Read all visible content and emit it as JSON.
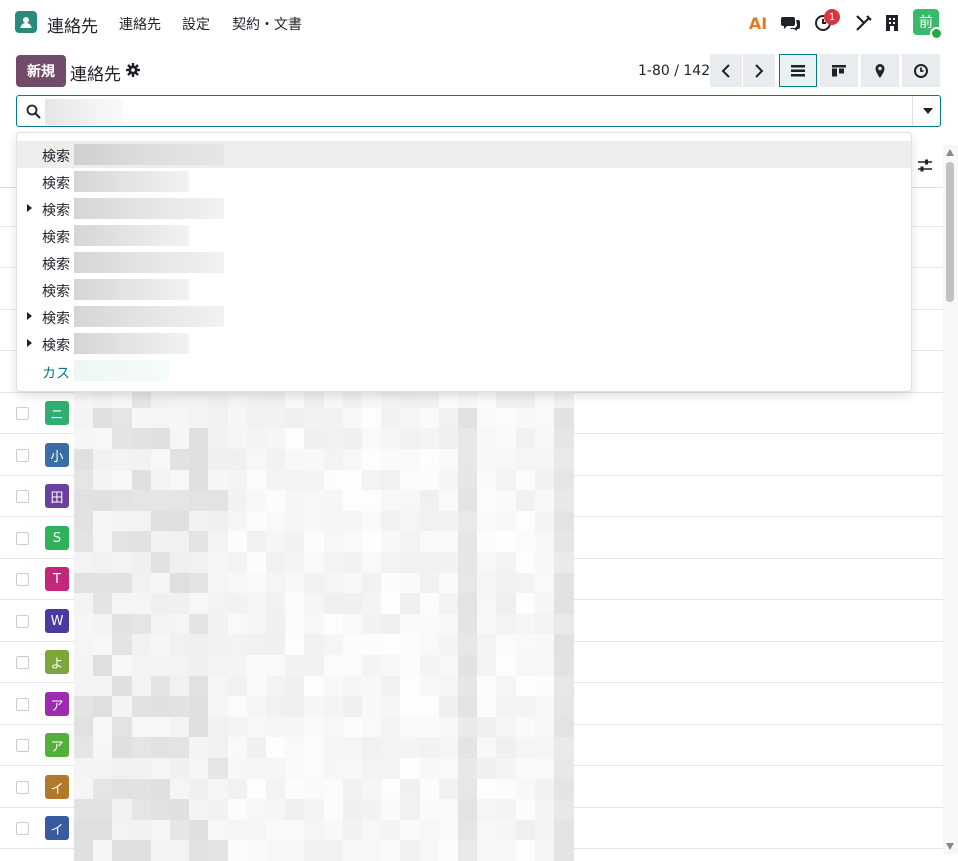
{
  "topnav": {
    "app_name": "連絡先",
    "menu": [
      "連絡先",
      "設定",
      "契約・文書"
    ],
    "ai_label": "AI",
    "activity_count": "1",
    "user_initial": "前"
  },
  "control_panel": {
    "new_button": "新規",
    "breadcrumb": "連絡先",
    "pager": "1-80 / 142"
  },
  "search": {
    "placeholder": "",
    "value": ""
  },
  "dropdown": {
    "items": [
      {
        "label": "検索",
        "expandable": false
      },
      {
        "label": "検索",
        "expandable": false
      },
      {
        "label": "検索",
        "expandable": true
      },
      {
        "label": "検索",
        "expandable": false
      },
      {
        "label": "検索",
        "expandable": false
      },
      {
        "label": "検索",
        "expandable": false
      },
      {
        "label": "検索",
        "expandable": true
      },
      {
        "label": "検索",
        "expandable": true
      }
    ],
    "custom_label": "カス"
  },
  "rows": [
    {
      "initial": "ニ",
      "color": "#2fae6f"
    },
    {
      "initial": "小",
      "color": "#3b6ea3"
    },
    {
      "initial": "田",
      "color": "#6a3fa0"
    },
    {
      "initial": "S",
      "color": "#2fb35a"
    },
    {
      "initial": "T",
      "color": "#c0297a"
    },
    {
      "initial": "W",
      "color": "#4a3aa0"
    },
    {
      "initial": "よ",
      "color": "#7aa63a"
    },
    {
      "initial": "ア",
      "color": "#9c2bb0"
    },
    {
      "initial": "ア",
      "color": "#52b03a"
    },
    {
      "initial": "イ",
      "color": "#b07a2a"
    },
    {
      "initial": "イ",
      "color": "#3a5aa0"
    }
  ],
  "colors": {
    "primary": "#714b67",
    "accent": "#017e84",
    "app_logo": "#2b8a7e"
  }
}
